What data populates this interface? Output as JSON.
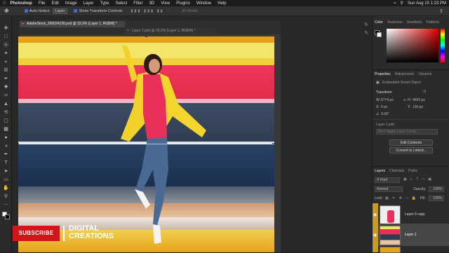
{
  "menubar": {
    "app": "Photoshop",
    "items": [
      "File",
      "Edit",
      "Image",
      "Layer",
      "Type",
      "Select",
      "Filter",
      "3D",
      "View",
      "Plugins",
      "Window",
      "Help"
    ],
    "clock": "Sun Aug 15  1:23 PM"
  },
  "options": {
    "auto_select_label": "Auto-Select:",
    "auto_select_value": "Layer",
    "transform_label": "Show Transform Controls",
    "mode_3d": "3D Mode:"
  },
  "tabs": {
    "active": "AdobeStock_266024199.psd @ 33.3% (Layer 1, RGB/8) *",
    "second": "Layer 1.psb @ 33.3% (Layer 1, RGB/8) *"
  },
  "overlay": {
    "subscribe": "SUBSCRIBE",
    "brand_line1": "DIGITAL",
    "brand_line2": "CREATIONS"
  },
  "color_panel": {
    "tabs": [
      "Color",
      "Swatches",
      "Gradients",
      "Patterns"
    ]
  },
  "properties": {
    "tabs": [
      "Properties",
      "Adjustments",
      "Libraries"
    ],
    "type_label": "Embedded Smart Object",
    "transform_label": "Transform",
    "w_label": "W:",
    "w_value": "5774 px",
    "h_label": "H:",
    "h_value": "4655 px",
    "x_label": "X:",
    "x_value": "0 px",
    "y_label": "Y:",
    "y_value": "130 px",
    "angle_value": "0.00°",
    "file_label": "Layer 1.psb",
    "comp_placeholder": "Don't Apply Layer Comp",
    "edit_button": "Edit Contents",
    "convert_button": "Convert to Linked..."
  },
  "layers": {
    "tabs": [
      "Layers",
      "Channels",
      "Paths"
    ],
    "filter": "Kind",
    "blend_mode": "Normal",
    "opacity_label": "Opacity:",
    "opacity_value": "100%",
    "lock_label": "Lock:",
    "fill_label": "Fill:",
    "fill_value": "100%",
    "items": [
      {
        "name": "Layer 0 copy"
      },
      {
        "name": "Layer 1"
      }
    ]
  },
  "colors": {
    "accent": "#3a6fd9",
    "subscribe_red": "#d0161b"
  }
}
